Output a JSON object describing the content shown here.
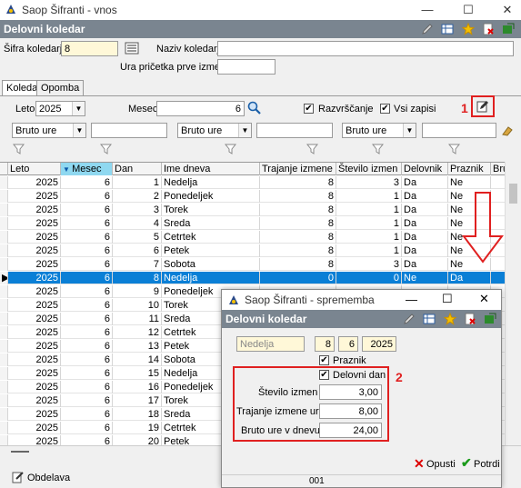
{
  "window": {
    "title": "Saop   Šifranti - vnos",
    "header": "Delovni koledar",
    "controls": [
      "—",
      "☐",
      "✕"
    ]
  },
  "form": {
    "sifra_label": "Šifra koledarja",
    "sifra_value": "8",
    "naziv_label": "Naziv koledarja",
    "naziv_value": "",
    "ura_label": "Ura pričetka prve izmene",
    "ura_value": ""
  },
  "tabs": [
    "Koledar",
    "Opomba"
  ],
  "filter": {
    "leto_label": "Leto",
    "leto_value": "2025",
    "mesec_label": "Mesec",
    "mesec_value": "6",
    "razvrscanje_label": "Razvrščanje",
    "vsi_zapisi_label": "Vsi zapisi",
    "annotation_1": "1",
    "combo_1": "Bruto ure",
    "combo_2": "Bruto ure",
    "combo_3": "Bruto ure"
  },
  "grid": {
    "columns": [
      "Leto",
      "Mesec",
      "Dan",
      "Ime dneva",
      "Trajanje izmene",
      "Število izmen",
      "Delovnik",
      "Praznik",
      "Bru"
    ],
    "rows": [
      [
        "2025",
        "6",
        "1",
        "Nedelja",
        "8",
        "3",
        "Da",
        "Ne"
      ],
      [
        "2025",
        "6",
        "2",
        "Ponedeljek",
        "8",
        "1",
        "Da",
        "Ne"
      ],
      [
        "2025",
        "6",
        "3",
        "Torek",
        "8",
        "1",
        "Da",
        "Ne"
      ],
      [
        "2025",
        "6",
        "4",
        "Sreda",
        "8",
        "1",
        "Da",
        "Ne"
      ],
      [
        "2025",
        "6",
        "5",
        "Cetrtek",
        "8",
        "1",
        "Da",
        "Ne"
      ],
      [
        "2025",
        "6",
        "6",
        "Petek",
        "8",
        "1",
        "Da",
        "Ne"
      ],
      [
        "2025",
        "6",
        "7",
        "Sobota",
        "8",
        "3",
        "Da",
        "Ne"
      ],
      [
        "2025",
        "6",
        "8",
        "Nedelja",
        "0",
        "0",
        "Ne",
        "Da"
      ],
      [
        "2025",
        "6",
        "9",
        "Ponedeljek",
        "",
        "",
        "",
        ""
      ],
      [
        "2025",
        "6",
        "10",
        "Torek",
        "",
        "",
        "",
        ""
      ],
      [
        "2025",
        "6",
        "11",
        "Sreda",
        "",
        "",
        "",
        ""
      ],
      [
        "2025",
        "6",
        "12",
        "Cetrtek",
        "",
        "",
        "",
        ""
      ],
      [
        "2025",
        "6",
        "13",
        "Petek",
        "",
        "",
        "",
        ""
      ],
      [
        "2025",
        "6",
        "14",
        "Sobota",
        "",
        "",
        "",
        ""
      ],
      [
        "2025",
        "6",
        "15",
        "Nedelja",
        "",
        "",
        "",
        ""
      ],
      [
        "2025",
        "6",
        "16",
        "Ponedeljek",
        "",
        "",
        "",
        ""
      ],
      [
        "2025",
        "6",
        "17",
        "Torek",
        "",
        "",
        "",
        ""
      ],
      [
        "2025",
        "6",
        "18",
        "Sreda",
        "",
        "",
        "",
        ""
      ],
      [
        "2025",
        "6",
        "19",
        "Cetrtek",
        "",
        "",
        "",
        ""
      ],
      [
        "2025",
        "6",
        "20",
        "Petek",
        "",
        "",
        "",
        ""
      ]
    ],
    "selected_row": 7
  },
  "footer": {
    "obdelava_label": "Obdelava",
    "record_no": "001"
  },
  "dialog": {
    "title": "Saop   Šifranti  - sprememba",
    "header": "Delovni koledar",
    "day_name": "Nedelja",
    "day": "8",
    "month": "6",
    "year": "2025",
    "praznik_label": "Praznik",
    "delovni_dan_label": "Delovni dan",
    "stevilo_izmen_label": "Število izmen",
    "stevilo_izmen_value": "3,00",
    "trajanje_label": "Trajanje izmene ure",
    "trajanje_value": "8,00",
    "bruto_label": "Bruto ure v dnevu",
    "bruto_value": "24,00",
    "annotation_2": "2",
    "opusti_label": "Opusti",
    "potrdi_label": "Potrdi"
  },
  "colors": {
    "header_bg": "#7a8590",
    "selection": "#0a7fd6",
    "annotation": "#e02020",
    "input_yellow": "#fff8d8"
  }
}
